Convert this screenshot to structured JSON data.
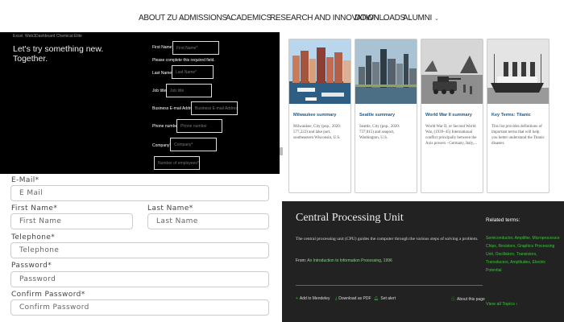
{
  "nav": {
    "items": [
      {
        "label": "ABOUT ZU",
        "chevron": true
      },
      {
        "label": "ADMISSIONS",
        "chevron": true
      },
      {
        "label": "ACADEMICS",
        "chevron": true
      },
      {
        "label": "RESEARCH AND INNOVATION",
        "chevron": true
      },
      {
        "label": "DOWNLOADS",
        "chevron": true
      },
      {
        "label": "ALUMNI",
        "chevron": true
      }
    ]
  },
  "black_form": {
    "tiny_text": "Excel. Web3Dashboard Chemical Elite",
    "headline_line1": "Let's try something new.",
    "headline_line2": "Together.",
    "first_name_label": "First Name*",
    "first_name_placeholder": "First Name*",
    "required_note": "Please complete this required field.",
    "last_name_label": "Last Name*",
    "last_name_placeholder": "Last Name*",
    "job_title_label": "Job title",
    "job_title_placeholder": "Job title",
    "email_label": "Business E-mail Address*",
    "email_placeholder": "Business E-mail Address*",
    "phone_label": "Phone number",
    "phone_placeholder": "Phone number",
    "company_label": "Company*",
    "company_placeholder": "Company*",
    "employees_placeholder": "Number of employees*"
  },
  "white_form": {
    "email_label": "E-Mail*",
    "email_placeholder": "E Mail",
    "first_name_label": "First Name*",
    "first_name_placeholder": "First Name",
    "last_name_label": "Last Name*",
    "last_name_placeholder": "Last Name",
    "telephone_label": "Telephone*",
    "telephone_placeholder": "Telephone",
    "password_label": "Password*",
    "password_placeholder": "Password",
    "confirm_label": "Confirm Password*",
    "confirm_placeholder": "Confirm Password"
  },
  "cards": [
    {
      "title": "Milwaukee summary",
      "description": "Milwaukee, City (pop., 2020: 577,222) and lake port, southeastern Wisconsin, U.S."
    },
    {
      "title": "Seattle summary",
      "description": "Seattle, City (pop., 2020: 737,015) and seaport, Washington, U.S."
    },
    {
      "title": "World War II summary",
      "description": "World War II, or Second World War, (1939–45) International conflict principally between the Axis powers - Germany, Italy,..."
    },
    {
      "title": "Key Terms: Titanic",
      "description": "This list provides definitions of important terms that will help you better understand the Titanic disaster."
    }
  ],
  "cpu": {
    "title": "Central Processing Unit",
    "body": "The central processing unit (CPU) guides the computer through the various steps of solving a problem.",
    "from_prefix": "From: ",
    "from_link": "An Introduction to Information Processing, 1996",
    "related_title": "Related terms:",
    "related_terms": "Semiconductor, Amplifier, Microprocessor Chips, Resistors, Graphics Processing Unit, Oscillators, Transistors, Transducers, Amplitudes, Electric Potential",
    "actions": [
      "Add to Mendeley",
      "Download as PDF",
      "Set alert",
      "About this page"
    ],
    "view_all": "View all Topics"
  },
  "colors": {
    "black_panel": "#000000",
    "cpu_panel": "#222222",
    "link_green": "#3ec43e",
    "card_title_blue": "#1a5a8a"
  }
}
